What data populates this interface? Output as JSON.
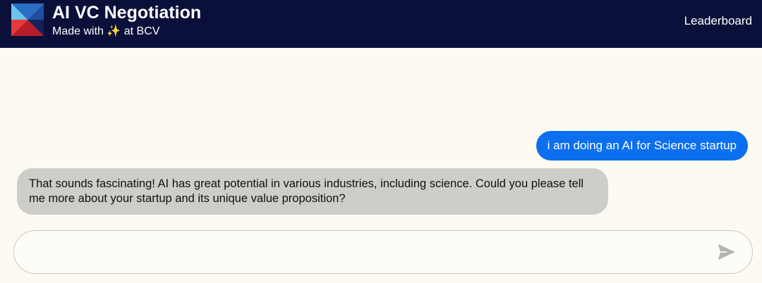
{
  "header": {
    "title": "AI VC Negotiation",
    "subtitle": "Made with ✨ at BCV",
    "nav_link": "Leaderboard",
    "logo_icon": "bcv-logo-icon",
    "background_color": "#0a1039"
  },
  "chat": {
    "messages": [
      {
        "role": "user",
        "text": "i am doing an AI for Science startup"
      },
      {
        "role": "assistant",
        "text": "That sounds fascinating! AI has great potential in various industries, including science. Could you please tell me more about your startup and its unique value proposition?"
      }
    ],
    "user_bubble_color": "#0b6ff0",
    "assistant_bubble_color": "#cdcdc9"
  },
  "composer": {
    "value": "",
    "placeholder": "",
    "send_icon": "send-icon"
  }
}
